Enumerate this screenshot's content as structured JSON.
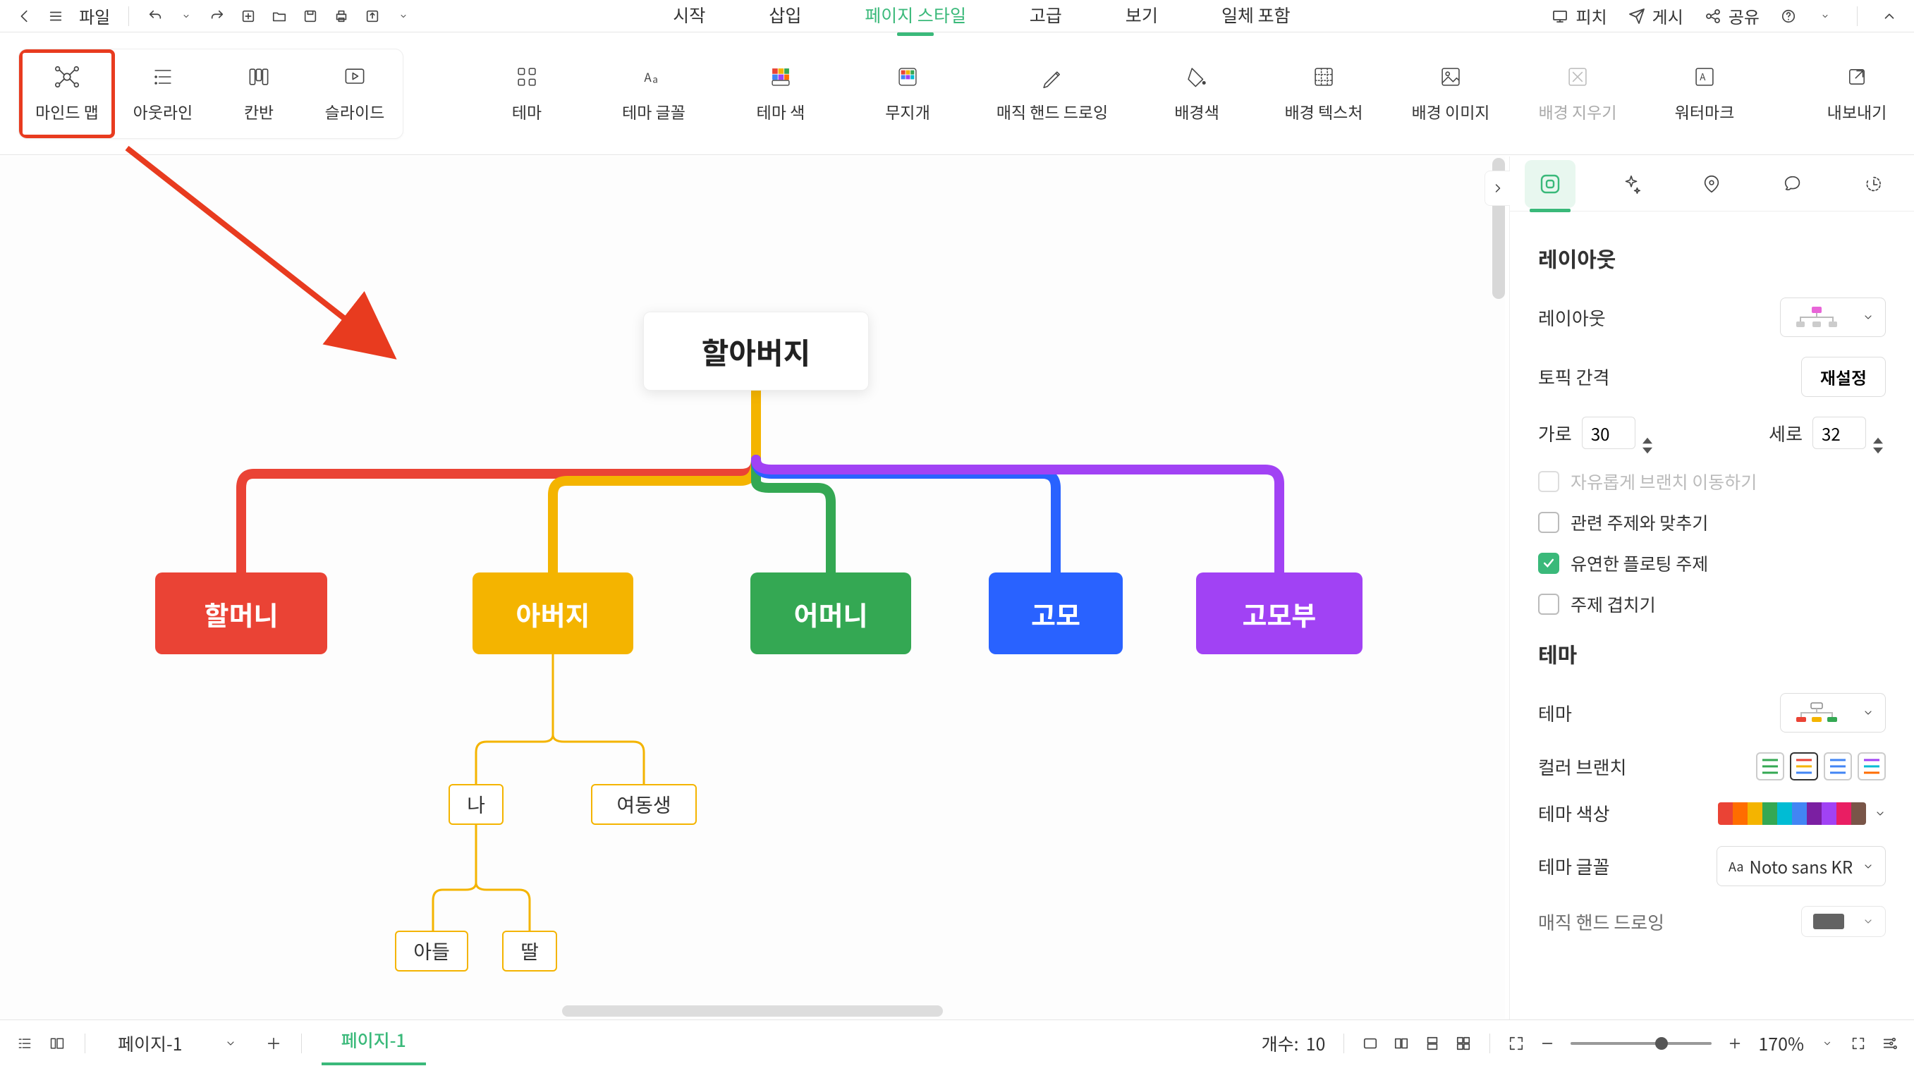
{
  "top": {
    "file": "파일",
    "menu": {
      "start": "시작",
      "insert": "삽입",
      "page_style": "페이지 스타일",
      "advanced": "고급",
      "view": "보기",
      "help": "일체 포함"
    },
    "right": {
      "pitch": "피치",
      "publish": "게시",
      "share": "공유"
    }
  },
  "toolbar": {
    "views": {
      "mindmap": "마인드 맵",
      "outline": "아웃라인",
      "kanban": "칸반",
      "slide": "슬라이드"
    },
    "style": {
      "theme": "테마",
      "theme_font": "테마 글꼴",
      "theme_color": "테마 색",
      "rainbow": "무지개",
      "hand": "매직 핸드 드로잉",
      "bg_color": "배경색",
      "bg_texture": "배경 텍스처",
      "bg_image": "배경 이미지",
      "bg_clear": "배경 지우기",
      "watermark": "워터마크"
    },
    "export": "내보내기"
  },
  "mindmap": {
    "root": "할아버지",
    "b1": "할머니",
    "b2": "아버지",
    "b3": "어머니",
    "b4": "고모",
    "b5": "고모부",
    "s_na": "나",
    "s_sis": "여동생",
    "s_son": "아들",
    "s_dau": "딸"
  },
  "panel": {
    "layout_heading": "레이아웃",
    "layout_label": "레이아웃",
    "spacing_label": "토픽 간격",
    "reset_btn": "재설정",
    "horiz_label": "가로",
    "horiz_val": "30",
    "vert_label": "세로",
    "vert_val": "32",
    "cb_free": "자유롭게 브랜치 이동하기",
    "cb_align": "관련 주제와 맞추기",
    "cb_float": "유연한 플로팅 주제",
    "cb_overlap": "주제 겹치기",
    "theme_heading": "테마",
    "theme_label": "테마",
    "color_branch_label": "컬러 브랜치",
    "theme_color_label": "테마 색상",
    "theme_font_label": "테마 글꼴",
    "theme_font_value": "Noto sans KR",
    "magic_hand_label": "매직 핸드 드로잉"
  },
  "bottom": {
    "page_select": "페이지-1",
    "page_tab": "페이지-1",
    "count_label": "개수:",
    "count_value": "10",
    "zoom": "170%"
  }
}
